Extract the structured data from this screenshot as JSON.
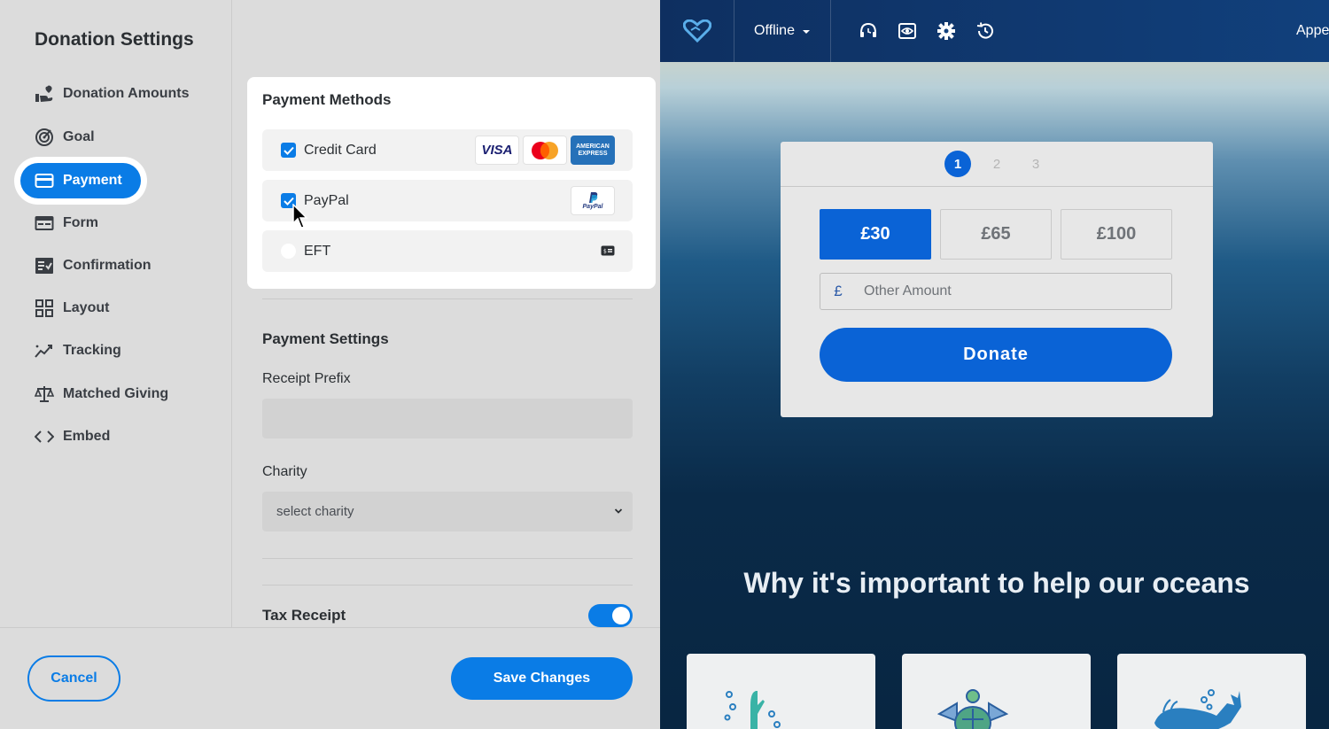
{
  "settings": {
    "title": "Donation Settings",
    "nav": [
      {
        "label": "Donation Amounts",
        "icon": "hand-heart-icon"
      },
      {
        "label": "Goal",
        "icon": "target-icon"
      },
      {
        "label": "Payment",
        "icon": "credit-card-icon",
        "active": true
      },
      {
        "label": "Form",
        "icon": "form-icon"
      },
      {
        "label": "Confirmation",
        "icon": "checklist-icon"
      },
      {
        "label": "Layout",
        "icon": "grid-icon"
      },
      {
        "label": "Tracking",
        "icon": "trend-icon"
      },
      {
        "label": "Matched Giving",
        "icon": "scale-icon"
      },
      {
        "label": "Embed",
        "icon": "code-icon"
      }
    ],
    "payment_methods": {
      "title": "Payment Methods",
      "methods": [
        {
          "label": "Credit Card",
          "checked": true,
          "logos": [
            "VISA",
            "mastercard-logo-icon",
            "AMERICAN EXPRESS"
          ]
        },
        {
          "label": "PayPal",
          "checked": true,
          "logos": [
            "PayPal"
          ]
        },
        {
          "label": "EFT",
          "checked": false,
          "logos": [
            "cash-icon"
          ]
        }
      ]
    },
    "payment_settings": {
      "title": "Payment Settings",
      "receipt_prefix_label": "Receipt Prefix",
      "receipt_prefix_value": "",
      "charity_label": "Charity",
      "charity_value": "select charity",
      "tax_receipt_label": "Tax Receipt",
      "tax_receipt_on": true
    },
    "footer": {
      "cancel_label": "Cancel",
      "save_label": "Save Changes"
    }
  },
  "preview": {
    "topbar": {
      "status": "Offline",
      "icons": [
        "headset-icon",
        "eye-icon",
        "gear-icon",
        "history-icon"
      ],
      "appearance": "Appe"
    },
    "donate_form": {
      "steps": [
        "1",
        "2",
        "3"
      ],
      "active_step": "1",
      "amounts": [
        "£30",
        "£65",
        "£100"
      ],
      "selected_amount": "£30",
      "currency_symbol": "£",
      "other_amount_placeholder": "Other Amount",
      "donate_label": "Donate"
    },
    "why_title": "Why it's important to help our oceans",
    "cards": [
      "coral-icon",
      "turtle-icon",
      "whale-icon"
    ]
  },
  "colors": {
    "accent": "#0a7ce6",
    "form_blue": "#0a63d6",
    "panel_bg": "#dcdcdc"
  }
}
